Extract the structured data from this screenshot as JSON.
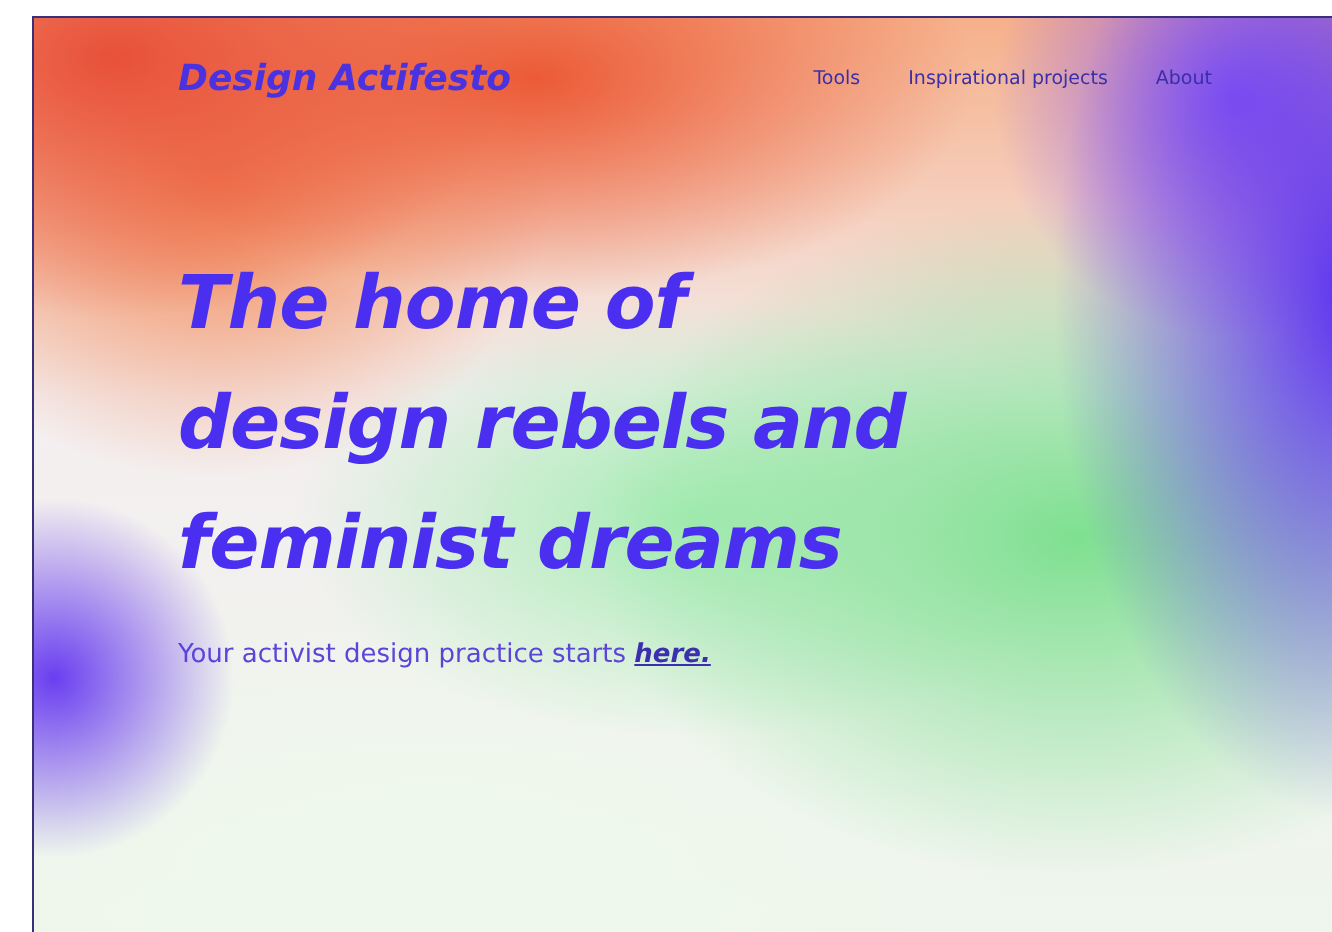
{
  "header": {
    "logo": "Design Actifesto",
    "nav": [
      "Tools",
      "Inspirational projects",
      "About"
    ]
  },
  "hero": {
    "headline_lines": [
      "The home of",
      "design rebels and",
      "feminist dreams"
    ],
    "lead": "Your activist design practice starts",
    "lead_link": "here."
  }
}
